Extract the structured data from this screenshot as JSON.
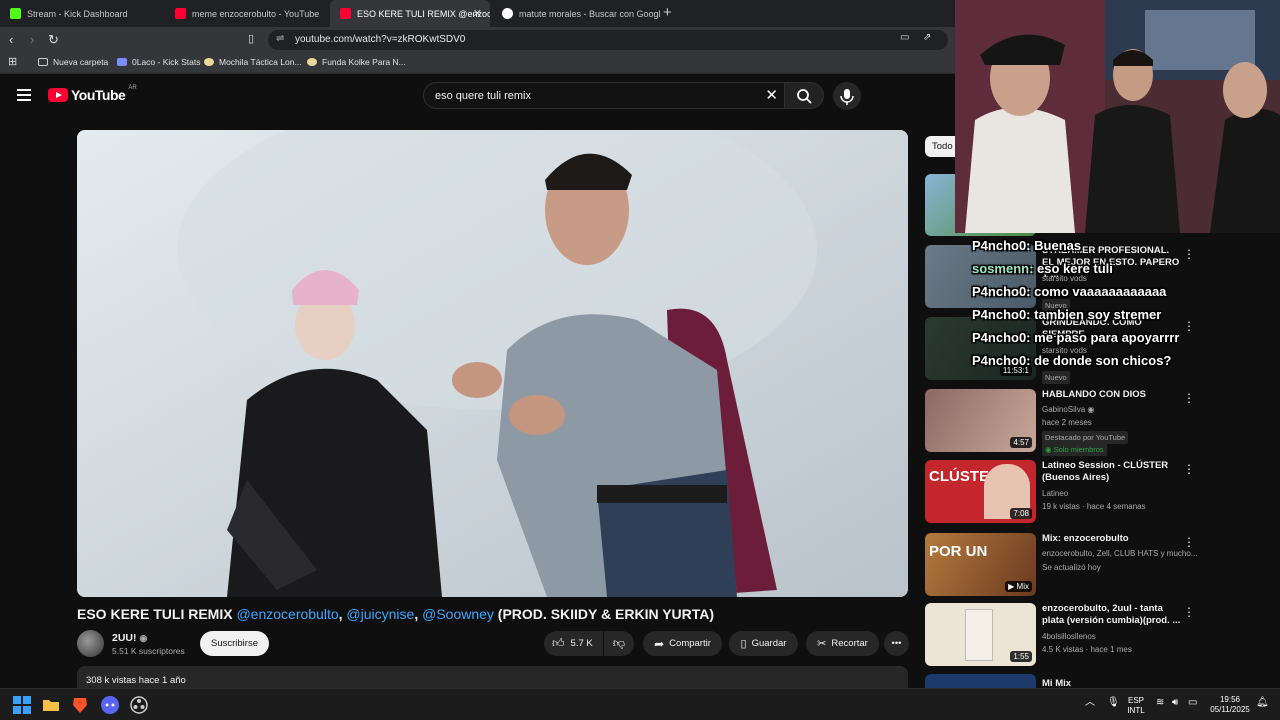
{
  "browser": {
    "tabs": [
      {
        "label": "Stream - Kick Dashboard",
        "favicon_color": "#53fc18"
      },
      {
        "label": "meme enzocerobulto - YouTube",
        "favicon_color": "#ff0033"
      },
      {
        "label": "ESO KERE TULI REMIX @enzocer",
        "favicon_color": "#ff0033",
        "active": true
      },
      {
        "label": "matute morales - Buscar con Google",
        "favicon_color": "#ffffff"
      }
    ],
    "url": "youtube.com/watch?v=zkROKwtSDV0",
    "bookmarks": [
      "Nueva carpeta",
      "0Laco - Kick Stats",
      "Mochila Táctica Lon...",
      "Funda Kolke Para N..."
    ]
  },
  "youtube": {
    "logo_text": "YouTube",
    "region": "AR",
    "search_query": "eso quere tuli remix",
    "video": {
      "title_parts": {
        "prefix": "ESO KERE TULI REMIX ",
        "m1": "@enzocerobulto",
        "sep1": ", ",
        "m2": "@juicynise",
        "sep2": ", ",
        "m3": "@Soowney",
        "suffix": " (PROD. SKIIDY & ERKIN YURTA)"
      },
      "channel": "2UU!",
      "subscribers": "5.51 K suscriptores",
      "subscribe_label": "Suscribirse",
      "likes": "5.7 K",
      "share_label": "Compartir",
      "save_label": "Guardar",
      "clip_label": "Recortar",
      "views_date": "308 k vistas  hace 1 año"
    },
    "sidebar": {
      "chip": "Todo",
      "items": [
        {
          "title": "STREAMER PROFESIONAL. EL MEJOR EN ESTO. PAPERO Y ...",
          "channel": "starsito vods",
          "meta": "",
          "badge": "Nuevo",
          "duration": "",
          "thumb": "#5a6e7a"
        },
        {
          "title": "GRINDEANDO. COMO SIEMPRE.",
          "channel": "starsito vods",
          "meta": "",
          "badge": "Nuevo",
          "duration": "11:53:1",
          "thumb": "#2e3a33"
        },
        {
          "title": "HABLANDO CON DIOS",
          "channel": "GabinoSilva",
          "meta": "hace 2 meses",
          "badge": "Destacado por YouTube",
          "badge2": "Solo miembros",
          "duration": "4:57",
          "thumb": "#7a5a55"
        },
        {
          "title": "Latineo Session - CLÚSTER (Buenos Aires)",
          "channel": "Latineo",
          "meta": "19 k vistas · hace 4 semanas",
          "duration": "7:08",
          "thumb": "#c4262e"
        },
        {
          "title": "Mix: enzocerobulto",
          "channel": "enzocerobulto, Zell, CLUB HATS y mucho...",
          "meta": "Se actualizó hoy",
          "duration": "Mix",
          "thumb": "#b0703a"
        },
        {
          "title": "enzocerobulto, 2uul - tanta plata (versión cumbia)(prod. ...",
          "channel": "4bolsillosllenos",
          "meta": "4.5 K vistas · hace 1 mes",
          "duration": "1:55",
          "thumb": "#e8dcc8"
        },
        {
          "title": "Mi Mix",
          "channel": "",
          "meta": "",
          "duration": "",
          "thumb": "#1c3a6a"
        }
      ]
    }
  },
  "chat": [
    {
      "user": "P4ncho0:",
      "msg": "Buenas"
    },
    {
      "user": "sosmenn:",
      "msg": "eso kere tuli"
    },
    {
      "user": "P4ncho0:",
      "msg": "como vaaaaaaaaaaaa"
    },
    {
      "user": "P4ncho0:",
      "msg": "tambien soy stremer"
    },
    {
      "user": "P4ncho0:",
      "msg": "me paso para apoyarrrr"
    },
    {
      "user": "P4ncho0:",
      "msg": "de donde son chicos?"
    }
  ],
  "taskbar": {
    "lang_top": "ESP",
    "lang_bottom": "INTL",
    "time": "19:56",
    "date": "05/11/2025"
  },
  "colors": {
    "youtube_red": "#ff0033",
    "link_blue": "#3ea6ff",
    "chat_user_green": "#9ee6c4"
  }
}
